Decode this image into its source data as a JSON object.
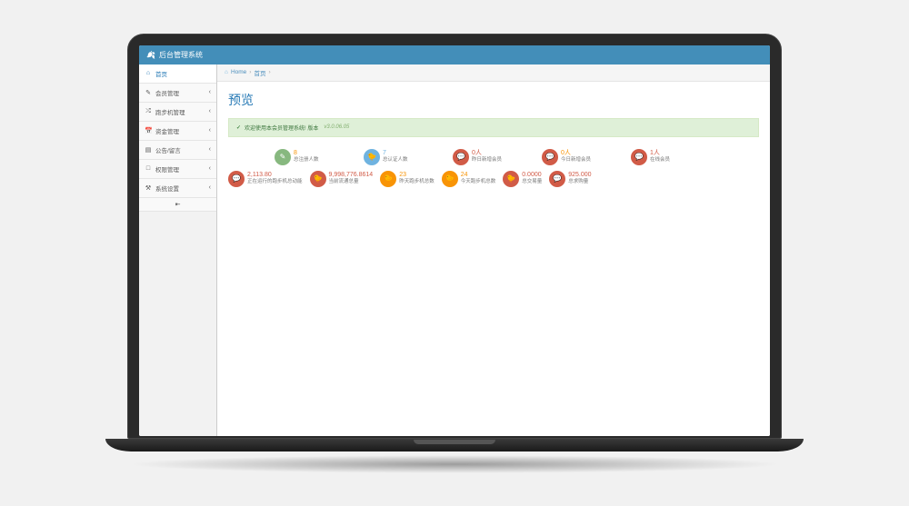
{
  "header": {
    "title": "后台管理系统"
  },
  "sidebar": {
    "items": [
      {
        "icon": "⌂",
        "label": "首页",
        "expandable": false,
        "active": true
      },
      {
        "icon": "✎",
        "label": "会员管理",
        "expandable": true
      },
      {
        "icon": "⤮",
        "label": "跑步机管理",
        "expandable": true
      },
      {
        "icon": "📅",
        "label": "资金管理",
        "expandable": true
      },
      {
        "icon": "▤",
        "label": "公告/留言",
        "expandable": true
      },
      {
        "icon": "□",
        "label": "权限管理",
        "expandable": true
      },
      {
        "icon": "⚒",
        "label": "系统设置",
        "expandable": true
      }
    ]
  },
  "breadcrumb": {
    "home": "Home",
    "current": "首页"
  },
  "page": {
    "title": "预览"
  },
  "alert": {
    "text": "欢迎使用本会员管理系统! 版本 ",
    "version": "v3.0.06.05"
  },
  "stats_row1": [
    {
      "circleClass": "c-green",
      "icon": "✎",
      "value": "8",
      "valueClass": "c-orange-txt",
      "label": "总注册人数"
    },
    {
      "circleClass": "c-blue",
      "icon": "🐤",
      "value": "7",
      "valueClass": "c-blue-txt",
      "label": "总认证人数"
    },
    {
      "circleClass": "c-red",
      "icon": "💬",
      "value": "0人",
      "valueClass": "c-red-txt",
      "label": "昨日新增会员"
    },
    {
      "circleClass": "c-red",
      "icon": "💬",
      "value": "0人",
      "valueClass": "c-orange-txt",
      "label": "今日新增会员"
    },
    {
      "circleClass": "c-red",
      "icon": "💬",
      "value": "1人",
      "valueClass": "c-red-txt",
      "label": "在线会员"
    }
  ],
  "stats_row2": [
    {
      "circleClass": "c-red",
      "icon": "💬",
      "value": "2,113.80",
      "valueClass": "c-red-txt",
      "label": "正在运行的跑步机总动能"
    },
    {
      "circleClass": "c-red",
      "icon": "🐤",
      "value": "9,998,776.8614",
      "valueClass": "c-red-txt",
      "label": "当前流通总量"
    },
    {
      "circleClass": "c-orange-fill",
      "icon": "🐤",
      "value": "23",
      "valueClass": "c-orange-txt",
      "label": "昨天跑步机总数"
    },
    {
      "circleClass": "c-orange-fill",
      "icon": "🐤",
      "value": "24",
      "valueClass": "c-orange-txt",
      "label": "今天跑步机总数"
    },
    {
      "circleClass": "c-red",
      "icon": "🐤",
      "value": "0.0000",
      "valueClass": "c-red-txt",
      "label": "总交易量"
    },
    {
      "circleClass": "c-red",
      "icon": "💬",
      "value": "925.000",
      "valueClass": "c-red-txt",
      "label": "总求购量"
    }
  ]
}
